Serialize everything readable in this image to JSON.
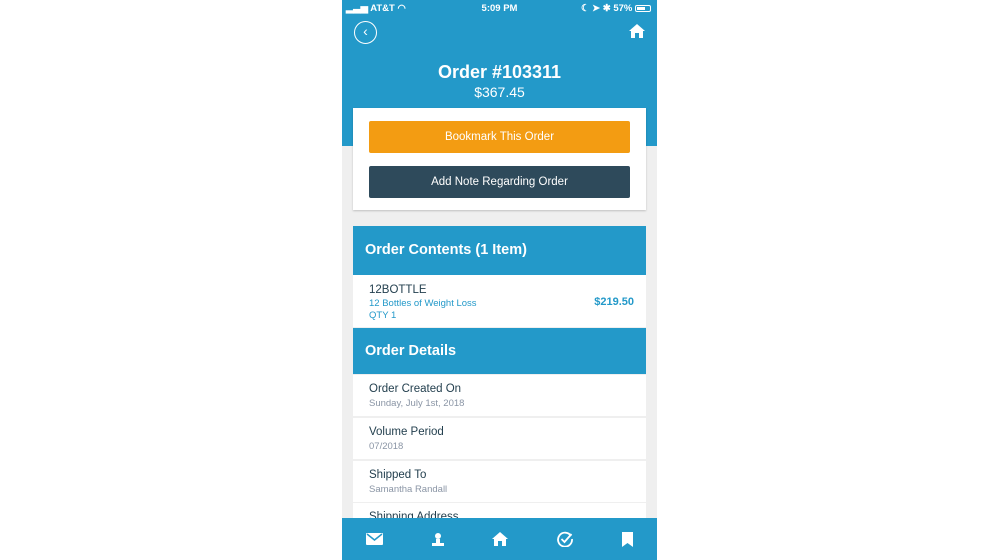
{
  "status": {
    "carrier": "AT&T",
    "time": "5:09 PM",
    "battery": "57%"
  },
  "header": {
    "title": "Order #103311",
    "total": "$367.45"
  },
  "actions": {
    "bookmark": "Bookmark This Order",
    "note": "Add Note Regarding Order"
  },
  "contents": {
    "heading": "Order Contents (1 Item)",
    "items": [
      {
        "sku": "12BOTTLE",
        "name": "12 Bottles of Weight Loss",
        "qty": "QTY 1",
        "price": "$219.50"
      }
    ]
  },
  "details": {
    "heading": "Order Details",
    "rows": [
      {
        "label": "Order Created On",
        "value": "Sunday, July 1st, 2018"
      },
      {
        "label": "Volume Period",
        "value": "07/2018"
      },
      {
        "label": "Shipped To",
        "value": "Samantha Randall"
      },
      {
        "label": "Shipping Address",
        "value": ""
      }
    ]
  },
  "tabbar": [
    "mail-icon",
    "profile-icon",
    "home-icon",
    "check-circle-icon",
    "bookmark-icon"
  ],
  "colors": {
    "primary": "#2399c9",
    "bookmark": "#f39c12",
    "note": "#2e4a5b"
  }
}
